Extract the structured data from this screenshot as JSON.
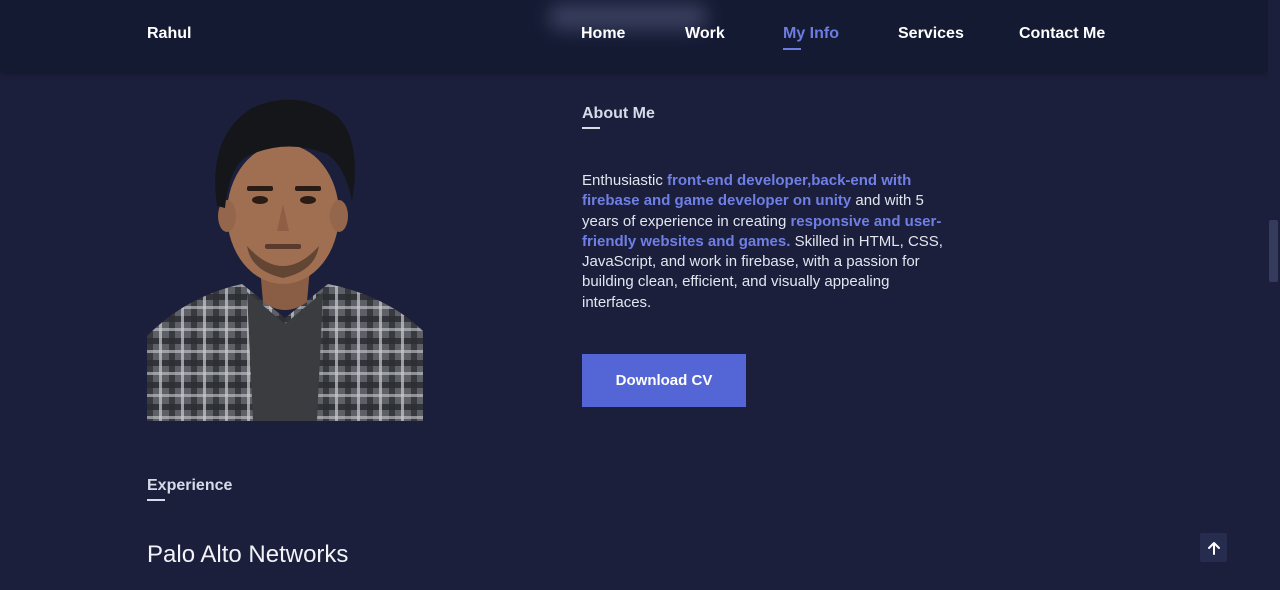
{
  "nav": {
    "brand": "Rahul",
    "links": [
      {
        "label": "Home"
      },
      {
        "label": "Work"
      },
      {
        "label": "My Info"
      },
      {
        "label": "Services"
      },
      {
        "label": "Contact Me"
      }
    ],
    "active_link": "My Info"
  },
  "about": {
    "title": "About Me",
    "text": {
      "p1": "Enthusiastic ",
      "h1": "front-end developer,back-end with firebase and game developer on unity",
      "p2": " and with 5 years of experience in creating ",
      "h2": "responsive and user-friendly websites and games.",
      "p3": " Skilled in HTML, CSS, JavaScript, and work in firebase, with a passion for building clean, efficient, and visually appealing interfaces."
    },
    "cv_button": "Download CV"
  },
  "experience": {
    "title": "Experience",
    "company": "Palo Alto Networks"
  },
  "colors": {
    "background": "#1b1f3b",
    "navbar": "#151a33",
    "accent": "#5466d6",
    "highlight": "#6f7fe6"
  },
  "icons": {
    "scroll_top": "arrow-up-icon"
  }
}
